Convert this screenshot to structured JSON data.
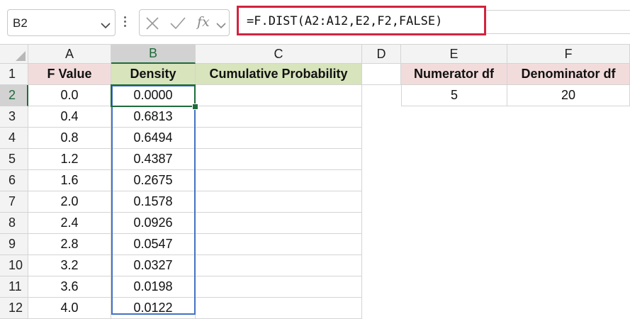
{
  "name_box": {
    "value": "B2"
  },
  "formula_bar": {
    "formula": "=F.DIST(A2:A12,E2,F2,FALSE)",
    "icons": [
      "cancel-icon",
      "enter-check-icon",
      "insert-function-icon",
      "expand-chevron-icon"
    ],
    "highlight_color": "#d3233f"
  },
  "columns": [
    "A",
    "B",
    "C",
    "D",
    "E",
    "F"
  ],
  "rows": [
    "1",
    "2",
    "3",
    "4",
    "5",
    "6",
    "7",
    "8",
    "9",
    "10",
    "11",
    "12"
  ],
  "table": {
    "headers": {
      "a": "F Value",
      "b": "Density",
      "c": "Cumulative Probability"
    },
    "f_values": [
      "0.0",
      "0.4",
      "0.8",
      "1.2",
      "1.6",
      "2.0",
      "2.4",
      "2.8",
      "3.2",
      "3.6",
      "4.0"
    ],
    "density": [
      "0.0000",
      "0.6813",
      "0.6494",
      "0.4387",
      "0.2675",
      "0.1578",
      "0.0926",
      "0.0547",
      "0.0327",
      "0.0198",
      "0.0122"
    ]
  },
  "params": {
    "numerator_label": "Numerator df",
    "denominator_label": "Denominator df",
    "numerator_value": "5",
    "denominator_value": "20"
  },
  "colors": {
    "header_pink": "#f2dcdb",
    "header_green": "#d8e4bc",
    "active_cell": "#1f6b3b",
    "selection": "#4472c4"
  }
}
